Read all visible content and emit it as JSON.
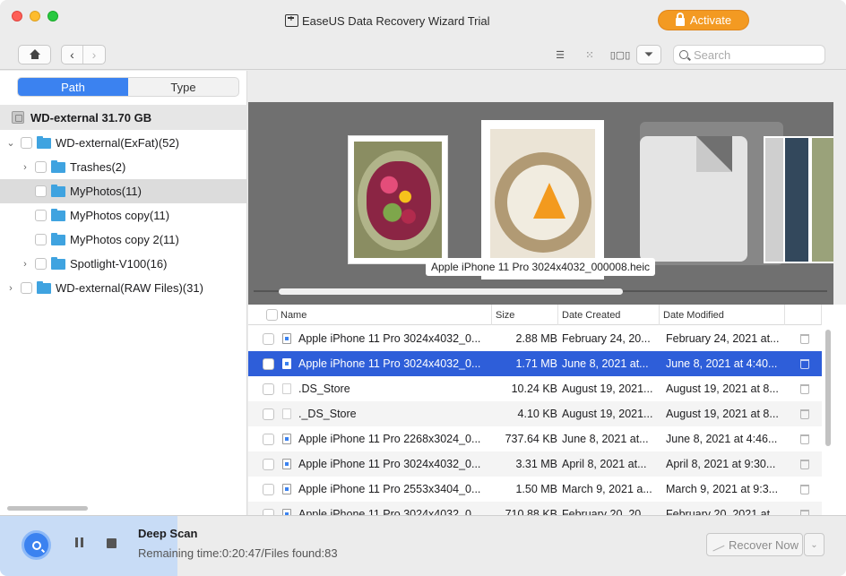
{
  "window": {
    "title": "EaseUS Data Recovery Wizard Trial",
    "activate_label": "Activate",
    "accent_color": "#3b82f0",
    "activate_color": "#f39a22"
  },
  "toolbar": {
    "search_placeholder": "Search",
    "icons": [
      "home-icon",
      "back-icon",
      "forward-icon",
      "list-view-icon",
      "grid-view-icon",
      "cover-flow-icon",
      "filter-icon",
      "search-icon"
    ]
  },
  "sidebar": {
    "tabs": [
      {
        "label": "Path",
        "active": true
      },
      {
        "label": "Type",
        "active": false
      }
    ],
    "drive": {
      "label": "WD-external 31.70 GB"
    },
    "tree": [
      {
        "label": "WD-external(ExFat)(52)",
        "chevron": "⌄",
        "selected": false
      },
      {
        "label": "Trashes(2)",
        "chevron": "›",
        "selected": false
      },
      {
        "label": "MyPhotos(11)",
        "chevron": "",
        "selected": true
      },
      {
        "label": "MyPhotos copy(11)",
        "chevron": "",
        "selected": false
      },
      {
        "label": "MyPhotos copy 2(11)",
        "chevron": "",
        "selected": false
      },
      {
        "label": "Spotlight-V100(16)",
        "chevron": "›",
        "selected": false
      },
      {
        "label": "WD-external(RAW Files)(31)",
        "chevron": "›",
        "selected": false
      }
    ]
  },
  "preview": {
    "caption": "Apple iPhone 11 Pro 3024x4032_000008.heic"
  },
  "table": {
    "columns": [
      "Name",
      "Size",
      "Date Created",
      "Date Modified"
    ],
    "rows": [
      {
        "name": "Apple iPhone 11 Pro 3024x4032_0...",
        "size": "2.88 MB",
        "created": "February 24, 20...",
        "modified": "February 24, 2021 at...",
        "icon": "image-file-icon",
        "selected": false
      },
      {
        "name": "Apple iPhone 11 Pro 3024x4032_0...",
        "size": "1.71 MB",
        "created": "June 8, 2021 at...",
        "modified": "June 8, 2021 at 4:40...",
        "icon": "image-file-icon",
        "selected": true
      },
      {
        "name": ".DS_Store",
        "size": "10.24 KB",
        "created": "August 19, 2021...",
        "modified": "August 19, 2021 at 8...",
        "icon": "blank-file-icon",
        "selected": false
      },
      {
        "name": "._DS_Store",
        "size": "4.10 KB",
        "created": "August 19, 2021...",
        "modified": "August 19, 2021 at 8...",
        "icon": "blank-file-icon",
        "selected": false
      },
      {
        "name": "Apple iPhone 11 Pro 2268x3024_0...",
        "size": "737.64 KB",
        "created": "June 8, 2021 at...",
        "modified": "June 8, 2021 at 4:46...",
        "icon": "image-file-icon",
        "selected": false
      },
      {
        "name": "Apple iPhone 11 Pro 3024x4032_0...",
        "size": "3.31 MB",
        "created": "April 8, 2021 at...",
        "modified": "April 8, 2021 at 9:30...",
        "icon": "image-file-icon",
        "selected": false
      },
      {
        "name": "Apple iPhone 11 Pro 2553x3404_0...",
        "size": "1.50 MB",
        "created": "March 9, 2021 a...",
        "modified": "March 9, 2021 at 9:3...",
        "icon": "image-file-icon",
        "selected": false
      },
      {
        "name": "Apple iPhone 11 Pro 3024x4032_0...",
        "size": "710.88 KB",
        "created": "February 20, 20...",
        "modified": "February 20, 2021 at...",
        "icon": "image-file-icon",
        "selected": false
      }
    ]
  },
  "bottom": {
    "scan_title": "Deep Scan",
    "scan_status": "Remaining time:0:20:47/Files found:83",
    "recover_label": "Recover Now"
  }
}
